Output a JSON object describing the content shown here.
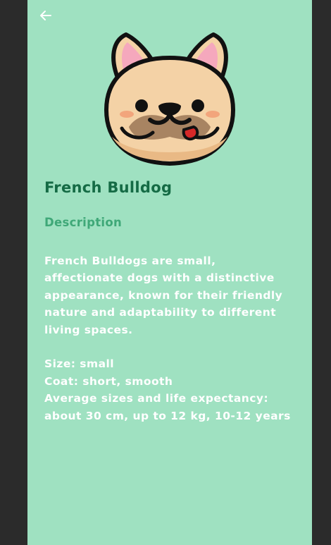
{
  "header": {
    "back_icon": "arrow-left-icon"
  },
  "breed": {
    "name": "French Bulldog",
    "image_icon": "french-bulldog-face-icon"
  },
  "description": {
    "heading": "Description",
    "lines": [
      "French Bulldogs are small,",
      "affectionate dogs with a distinctive",
      "appearance, known for their friendly",
      "nature and adaptability to different",
      "living spaces."
    ]
  },
  "details": {
    "size": "Size: small",
    "coat": "Coat: short, smooth",
    "measure_line1": "Average sizes and life expectancy:",
    "measure_line2": "about 30 cm, up to 12 kg, 10-12 years"
  },
  "colors": {
    "background": "#9fe1c1",
    "title": "#156b45",
    "heading": "#3fa878",
    "text": "#ffffff",
    "frame": "#2b2b2b"
  }
}
